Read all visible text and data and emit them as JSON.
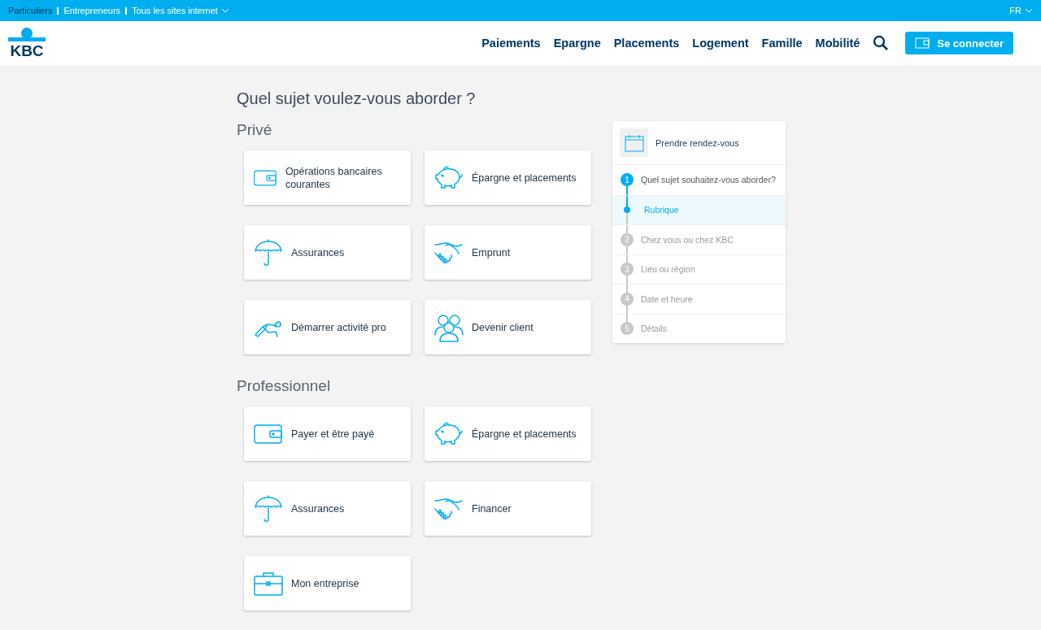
{
  "top_bar": {
    "links": [
      {
        "label": "Particuliers",
        "selected": true
      },
      {
        "label": "Entrepreneurs",
        "selected": false
      },
      {
        "label": "Tous les sites internet",
        "selected": false
      }
    ],
    "language": "FR"
  },
  "header": {
    "logo": "KBC",
    "nav": [
      "Paiements",
      "Epargne",
      "Placements",
      "Logement",
      "Famille",
      "Mobilité"
    ],
    "login_button": "Se connecter"
  },
  "title": "Quel sujet voulez-vous aborder ?",
  "sections": [
    {
      "heading": "Privé",
      "cards": [
        {
          "kind": "wallet",
          "label": "Opérations bancaires courantes"
        },
        {
          "kind": "piggy",
          "label": "Épargne et placements"
        },
        {
          "kind": "umbrella",
          "label": "Assurances"
        },
        {
          "kind": "handshake",
          "label": "Emprunt"
        },
        {
          "kind": "runner",
          "label": "Démarrer activité pro"
        },
        {
          "kind": "people",
          "label": "Devenir client"
        }
      ]
    },
    {
      "heading": "Professionnel",
      "cards": [
        {
          "kind": "wallet",
          "label": "Payer et être payé"
        },
        {
          "kind": "piggy",
          "label": "Épargne et placements"
        },
        {
          "kind": "umbrella",
          "label": "Assurances"
        },
        {
          "kind": "handshake",
          "label": "Financer"
        },
        {
          "kind": "briefcase",
          "label": "Mon entreprise"
        }
      ]
    }
  ],
  "appointment_panel": {
    "title": "Prendre rendez-vous",
    "steps": [
      {
        "kind": "step",
        "number": "1",
        "label": "Quel sujet souhaitez-vous aborder?",
        "active": true
      },
      {
        "kind": "substep",
        "label": "Rubrique",
        "selected": true
      },
      {
        "kind": "step",
        "number": "2",
        "label": "Chez vous ou chez KBC",
        "active": false
      },
      {
        "kind": "step",
        "number": "3",
        "label": "Lieu ou région",
        "active": false
      },
      {
        "kind": "step",
        "number": "4",
        "label": "Date et heure",
        "active": false
      },
      {
        "kind": "step",
        "number": "5",
        "label": "Détails",
        "active": false
      }
    ]
  }
}
